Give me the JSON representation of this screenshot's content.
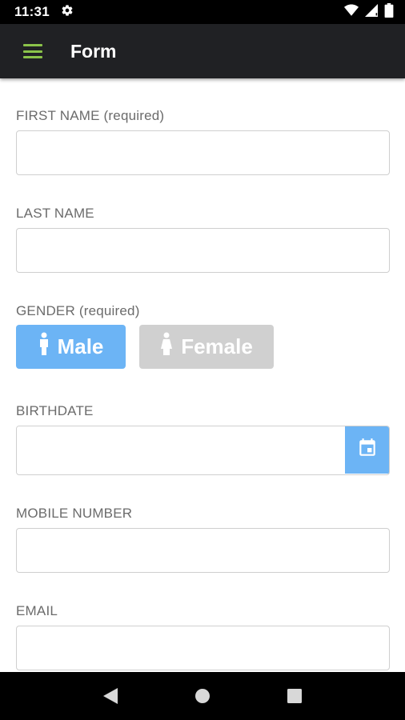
{
  "status_bar": {
    "time": "11:31",
    "icons": [
      "settings-gear-icon",
      "wifi-icon",
      "signal-icon",
      "battery-icon"
    ]
  },
  "app_bar": {
    "title": "Form",
    "menu_icon": "hamburger-menu-icon",
    "accent_color": "#8bc34a",
    "background_color": "#202124"
  },
  "form": {
    "first_name": {
      "label": "FIRST NAME (required)",
      "value": "",
      "placeholder": ""
    },
    "last_name": {
      "label": "LAST NAME",
      "value": "",
      "placeholder": ""
    },
    "gender": {
      "label": "GENDER (required)",
      "options": [
        {
          "label": "Male",
          "selected": true,
          "icon": "male-person-icon",
          "color": "#6cb4f5"
        },
        {
          "label": "Female",
          "selected": false,
          "icon": "female-person-icon",
          "color": "#d0d0d0"
        }
      ]
    },
    "birthdate": {
      "label": "BIRTHDATE",
      "value": "",
      "placeholder": "",
      "icon": "calendar-icon"
    },
    "mobile_number": {
      "label": "MOBILE NUMBER",
      "value": "",
      "placeholder": ""
    },
    "email": {
      "label": "EMAIL",
      "value": "",
      "placeholder": ""
    }
  },
  "nav_bar": {
    "items": [
      "back-icon",
      "home-icon",
      "recents-icon"
    ]
  }
}
